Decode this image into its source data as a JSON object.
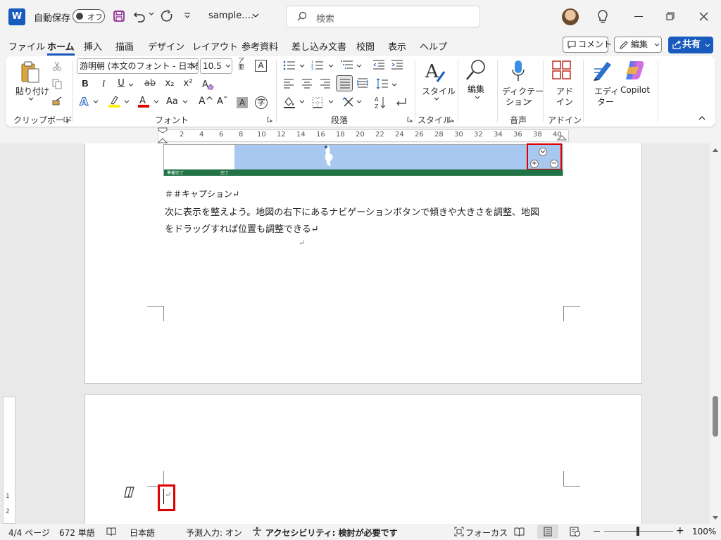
{
  "titlebar": {
    "app_icon": "W",
    "autosave_label": "自動保存",
    "autosave_state": "オフ",
    "filename": "sample.…",
    "search_placeholder": "検索"
  },
  "tabs": [
    "ファイル",
    "ホーム",
    "挿入",
    "描画",
    "デザイン",
    "レイアウト",
    "参考資料",
    "差し込み文書",
    "校閲",
    "表示",
    "ヘルプ"
  ],
  "active_tab": "ホーム",
  "actions": {
    "comment": "コメント",
    "edit": "編集",
    "share": "共有"
  },
  "ribbon": {
    "clipboard": {
      "paste": "貼り付け",
      "label": "クリップボード"
    },
    "font": {
      "font_name": "游明朝 (本文のフォント - 日本語)",
      "font_size": "10.5",
      "label": "フォント",
      "bold": "B",
      "italic": "I",
      "underline": "U",
      "strike": "ab",
      "subscript": "x₂",
      "superscript": "x²",
      "change_case": "Aa",
      "grow": "A^",
      "shrink": "Aˇ"
    },
    "paragraph": {
      "label": "段落"
    },
    "styles": {
      "button": "スタイル",
      "label": "スタイル"
    },
    "editing": {
      "button": "編集"
    },
    "voice": {
      "button_line1": "ディクテー",
      "button_line2": "ション",
      "label": "音声"
    },
    "addins": {
      "button_line1": "アド",
      "button_line2": "イン",
      "label": "アドイン"
    },
    "editor": {
      "line1": "エディ",
      "line2": "ター"
    },
    "copilot": {
      "button": "Copilot"
    }
  },
  "ruler": {
    "numbers": [
      "2",
      "4",
      "6",
      "8",
      "10",
      "12",
      "14",
      "16",
      "18",
      "20",
      "22",
      "24",
      "26",
      "28",
      "30",
      "32",
      "34",
      "36",
      "38",
      "40"
    ]
  },
  "vruler": {
    "numbers": [
      "1",
      "2"
    ]
  },
  "document": {
    "map_status_1": "準備完了",
    "map_status_2": "完了",
    "caption": "＃＃キャプション↵",
    "paragraph_line1": "次に表示を整えよう。地図の右下にあるナビゲーションボタンで傾きや大きさを調整、地図",
    "paragraph_line2": "をドラッグすれば位置も調整できる↵",
    "empty_para": "↵",
    "page5_para": "↵"
  },
  "status": {
    "page": "4/4 ページ",
    "words": "672 単語",
    "language": "日本語",
    "prediction": "予測入力: オン",
    "accessibility": "アクセシビリティ: 検討が必要です",
    "focus": "フォーカス",
    "zoom": "100%"
  },
  "colors": {
    "word_blue": "#185abd",
    "highlight_red": "#e00000",
    "map_water": "#a9c8f0",
    "map_bar": "#217346"
  }
}
